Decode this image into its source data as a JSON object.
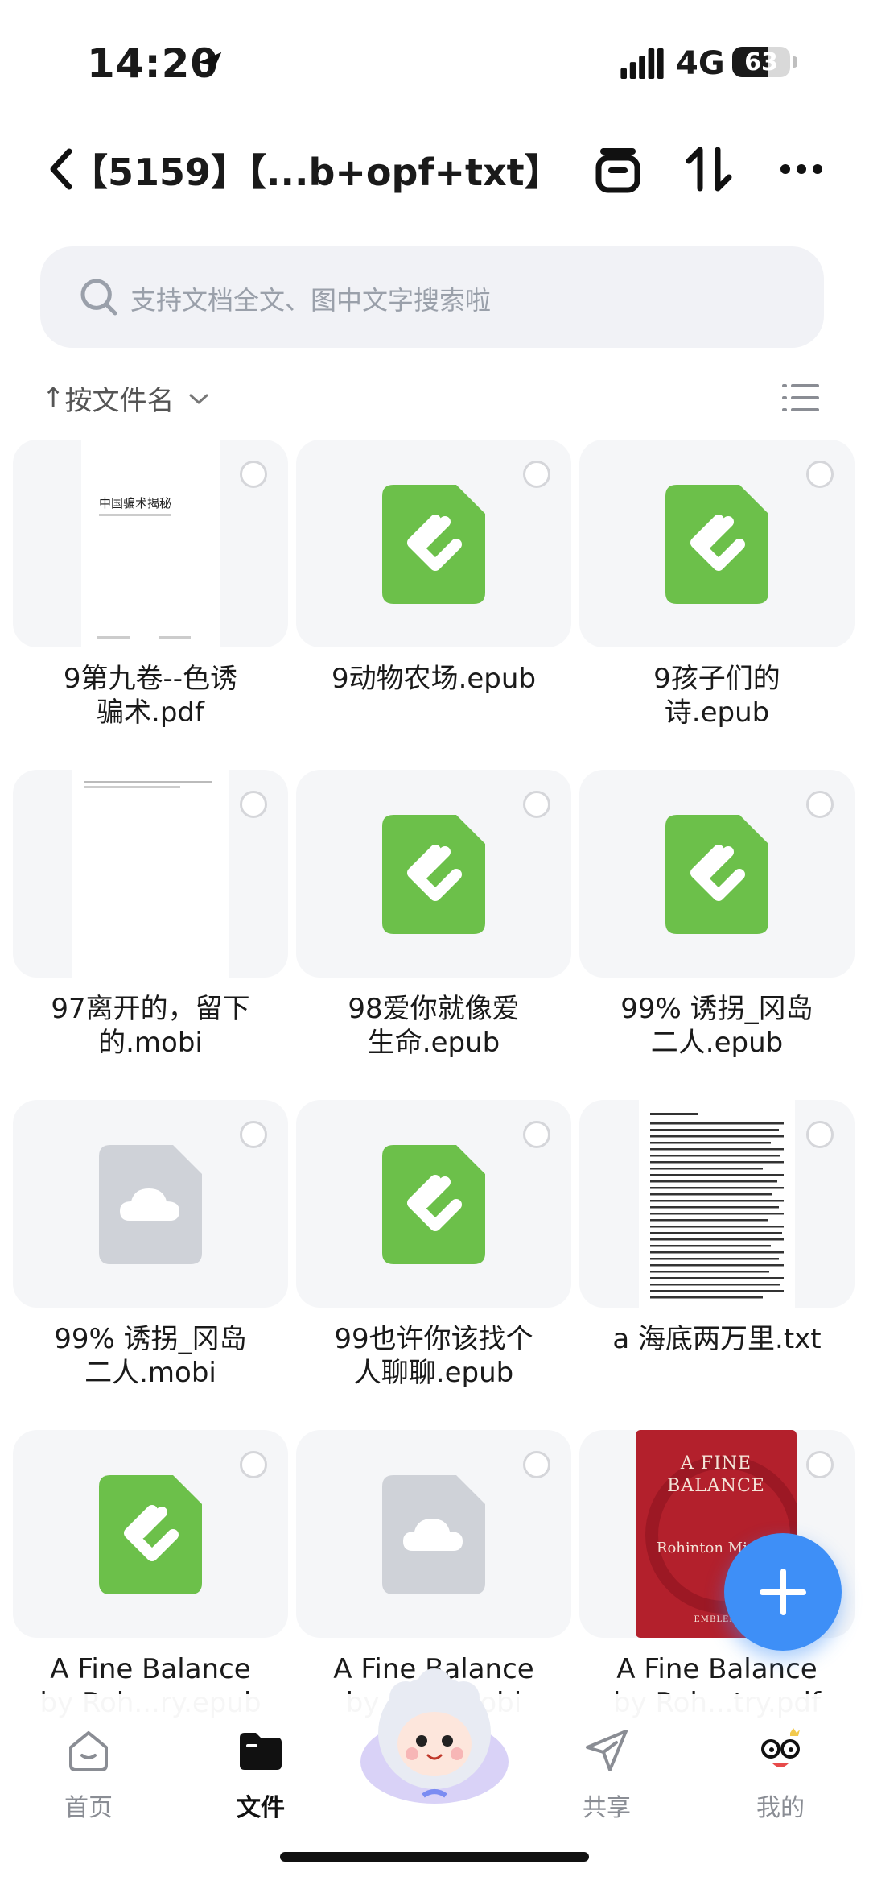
{
  "status": {
    "time": "14:20",
    "network": "4G",
    "battery": "63",
    "battery_level": 0.63
  },
  "header": {
    "title": "【...b+opf+txt】",
    "title_prefix": "【5159】"
  },
  "search": {
    "placeholder": "支持文档全文、图中文字搜索啦"
  },
  "sort": {
    "arrow": "↑",
    "label": "按文件名"
  },
  "files": [
    {
      "l1": "9第九卷--色诱",
      "l2": "骗术.pdf",
      "thumb": "pdf",
      "thumb_title": "中国骗术揭秘"
    },
    {
      "l1": "9动物农场.epub",
      "l2": "",
      "thumb": "epub"
    },
    {
      "l1": "9孩子们的",
      "l2": "诗.epub",
      "thumb": "epub"
    },
    {
      "l1": "97离开的，留下",
      "l2": "的.mobi",
      "thumb": "doc"
    },
    {
      "l1": "98爱你就像爱",
      "l2": "生命.epub",
      "thumb": "epub"
    },
    {
      "l1": "99% 诱拐_冈岛",
      "l2": "二人.epub",
      "thumb": "epub"
    },
    {
      "l1": "99% 诱拐_冈岛",
      "l2": "二人.mobi",
      "thumb": "cloud"
    },
    {
      "l1": "99也许你该找个",
      "l2": "人聊聊.epub",
      "thumb": "epub"
    },
    {
      "l1": "a 海底两万里.txt",
      "l2": "",
      "thumb": "txt"
    },
    {
      "l1": "A Fine Balance",
      "l2": "by Roh...ry.epub",
      "thumb": "epub"
    },
    {
      "l1": "A Fine Balance",
      "l2": "by R...y.mobi",
      "thumb": "cloud"
    },
    {
      "l1": "A Fine Balance",
      "l2": "by Roh...try.pdf",
      "thumb": "cover",
      "cover_title": "A FINE BALANCE",
      "cover_author": "Rohinton Mistry",
      "cover_publisher": "EMBLEM"
    }
  ],
  "tabs": [
    {
      "label": "首页",
      "icon": "home-icon"
    },
    {
      "label": "文件",
      "icon": "folder-icon"
    },
    {
      "label": "共享",
      "icon": "share-icon"
    },
    {
      "label": "我的",
      "icon": "profile-icon"
    }
  ],
  "colors": {
    "accent": "#3e8ff7",
    "epub_green": "#6cc04a",
    "cover_red": "#b3202c"
  }
}
